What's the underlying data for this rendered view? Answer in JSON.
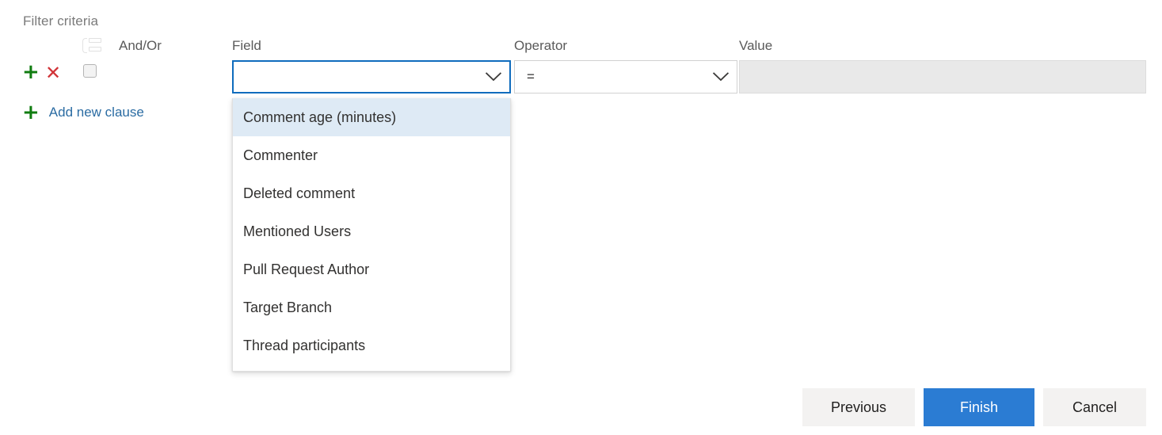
{
  "section": {
    "title": "Filter criteria"
  },
  "columns": {
    "group_icon": "group-clauses-icon",
    "and_or": "And/Or",
    "field": "Field",
    "operator": "Operator",
    "value": "Value"
  },
  "clause_row": {
    "add_icon": "plus-icon",
    "add_icon_glyph": "+",
    "remove_icon": "close-icon",
    "remove_icon_glyph": "✕",
    "grouping_checkbox_checked": false
  },
  "add_clause": {
    "icon": "plus-icon",
    "icon_glyph": "+",
    "label": "Add new clause"
  },
  "field_combo": {
    "value": "",
    "placeholder": "",
    "expanded": true,
    "chevron_icon": "chevron-down-icon"
  },
  "operator_combo": {
    "value": "=",
    "chevron_icon": "chevron-down-icon"
  },
  "value_field": {
    "value": "",
    "disabled": true
  },
  "field_dropdown": {
    "selected_index": 0,
    "options": [
      "Comment age (minutes)",
      "Commenter",
      "Deleted comment",
      "Mentioned Users",
      "Pull Request Author",
      "Target Branch",
      "Thread participants"
    ]
  },
  "footer": {
    "previous_label": "Previous",
    "finish_label": "Finish",
    "cancel_label": "Cancel"
  },
  "colors": {
    "accent": "#2b7cd3",
    "focus_border": "#0f6cbd",
    "link": "#2b6ca3",
    "add_green": "#107c10",
    "remove_red": "#d13438",
    "dropdown_selected_bg": "#deeaf5",
    "disabled_bg": "#e9e9e9",
    "button_secondary_bg": "#f3f2f1"
  }
}
